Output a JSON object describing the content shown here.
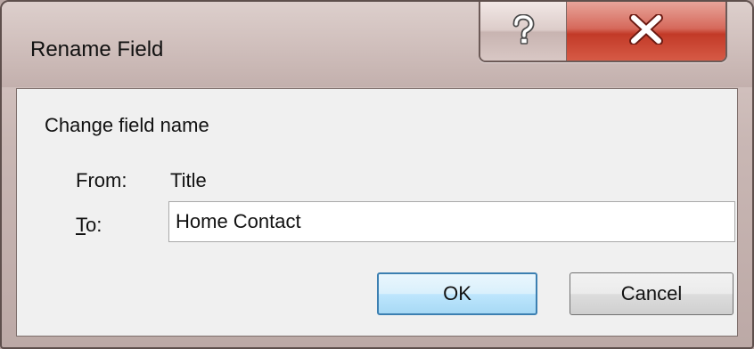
{
  "window": {
    "title": "Rename Field"
  },
  "caption_buttons": {
    "help_icon": "help-question-icon",
    "close_icon": "close-x-icon"
  },
  "dialog": {
    "heading": "Change field name",
    "from_label": "From:",
    "from_value": "Title",
    "to_label_mnemonic": "T",
    "to_label_rest": "o:",
    "to_value": "Home Contact",
    "ok_label": "OK",
    "cancel_label": "Cancel"
  },
  "colors": {
    "close_button": "#c23a28",
    "default_button_border": "#3c7fb1",
    "dialog_background": "#f0f0f0"
  }
}
